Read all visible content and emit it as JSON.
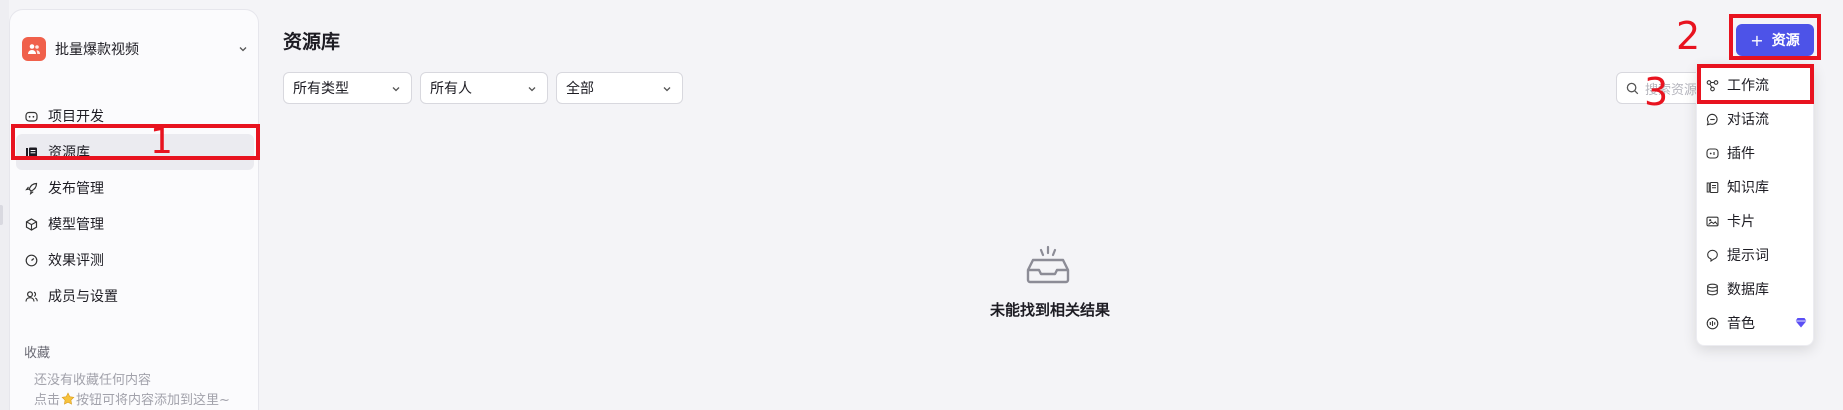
{
  "colors": {
    "accent": "#4d53e8",
    "annotation_red": "#e8131f",
    "space_avatar": "#f0604b",
    "gem": "#5b4ff5"
  },
  "workspace": {
    "name": "批量爆款视频",
    "avatar_icon": "people-icon"
  },
  "sidebar": {
    "items": [
      {
        "label": "项目开发",
        "icon": "bot-icon"
      },
      {
        "label": "资源库",
        "icon": "library-icon",
        "active": true
      },
      {
        "label": "发布管理",
        "icon": "rocket-icon"
      },
      {
        "label": "模型管理",
        "icon": "cube-icon"
      },
      {
        "label": "效果评测",
        "icon": "gauge-icon"
      },
      {
        "label": "成员与设置",
        "icon": "members-icon"
      }
    ],
    "favorites": {
      "title": "收藏",
      "empty_line1": "还没有收藏任何内容",
      "empty_line2_prefix": "点击",
      "empty_line2_suffix": "按钮可将内容添加到这里~"
    }
  },
  "main": {
    "title": "资源库",
    "filters": [
      {
        "value": "所有类型"
      },
      {
        "value": "所有人"
      },
      {
        "value": "全部"
      }
    ],
    "search_placeholder": "搜索资源",
    "add_button": {
      "icon": "+",
      "label": "资源"
    },
    "empty_text": "未能找到相关结果"
  },
  "menu": {
    "items": [
      {
        "label": "工作流",
        "icon": "workflow-icon"
      },
      {
        "label": "对话流",
        "icon": "chatflow-icon"
      },
      {
        "label": "插件",
        "icon": "plugin-icon"
      },
      {
        "label": "知识库",
        "icon": "knowledge-icon"
      },
      {
        "label": "卡片",
        "icon": "card-icon"
      },
      {
        "label": "提示词",
        "icon": "prompt-icon"
      },
      {
        "label": "数据库",
        "icon": "database-icon"
      },
      {
        "label": "音色",
        "icon": "voice-icon",
        "badge": "gem-icon"
      }
    ]
  },
  "annotations": {
    "one": "1",
    "two": "2",
    "three": "3"
  }
}
